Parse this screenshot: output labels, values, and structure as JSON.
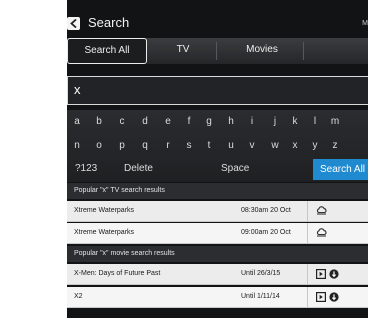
{
  "header": {
    "title": "Search",
    "user_initial": "M"
  },
  "tabs": [
    {
      "label": "Search All",
      "active": true
    },
    {
      "label": "TV",
      "active": false
    },
    {
      "label": "Movies",
      "active": false
    }
  ],
  "search": {
    "value": "x"
  },
  "keyboard": {
    "row1": [
      "a",
      "b",
      "c",
      "d",
      "e",
      "f",
      "g",
      "h",
      "i",
      "j",
      "k",
      "l",
      "m"
    ],
    "row2": [
      "n",
      "o",
      "p",
      "q",
      "r",
      "s",
      "t",
      "u",
      "v",
      "w",
      "x",
      "y",
      "z"
    ],
    "numbers_key": "?123",
    "delete_key": "Delete",
    "space_key": "Space",
    "search_all_key": "Search All"
  },
  "tv_results": {
    "heading": "Popular \"x\" TV search results",
    "items": [
      {
        "name": "Xtreme Waterparks",
        "time": "08:30am 20 Oct",
        "icon": "cloud-record-icon"
      },
      {
        "name": "Xtreme Waterparks",
        "time": "09:00am 20 Oct",
        "icon": "cloud-record-icon"
      }
    ]
  },
  "movie_results": {
    "heading": "Popular \"x\"  movie search results",
    "items": [
      {
        "name": "X-Men: Days of Future Past",
        "time": "Until 26/3/15",
        "icons": [
          "play-box-icon",
          "buy-icon"
        ]
      },
      {
        "name": "X2",
        "time": "Until 1/11/14",
        "icons": [
          "play-box-icon",
          "buy-icon"
        ]
      }
    ]
  },
  "colors": {
    "background": "#121314",
    "accent": "#1f8ad0",
    "row_bg": "#ececec"
  }
}
